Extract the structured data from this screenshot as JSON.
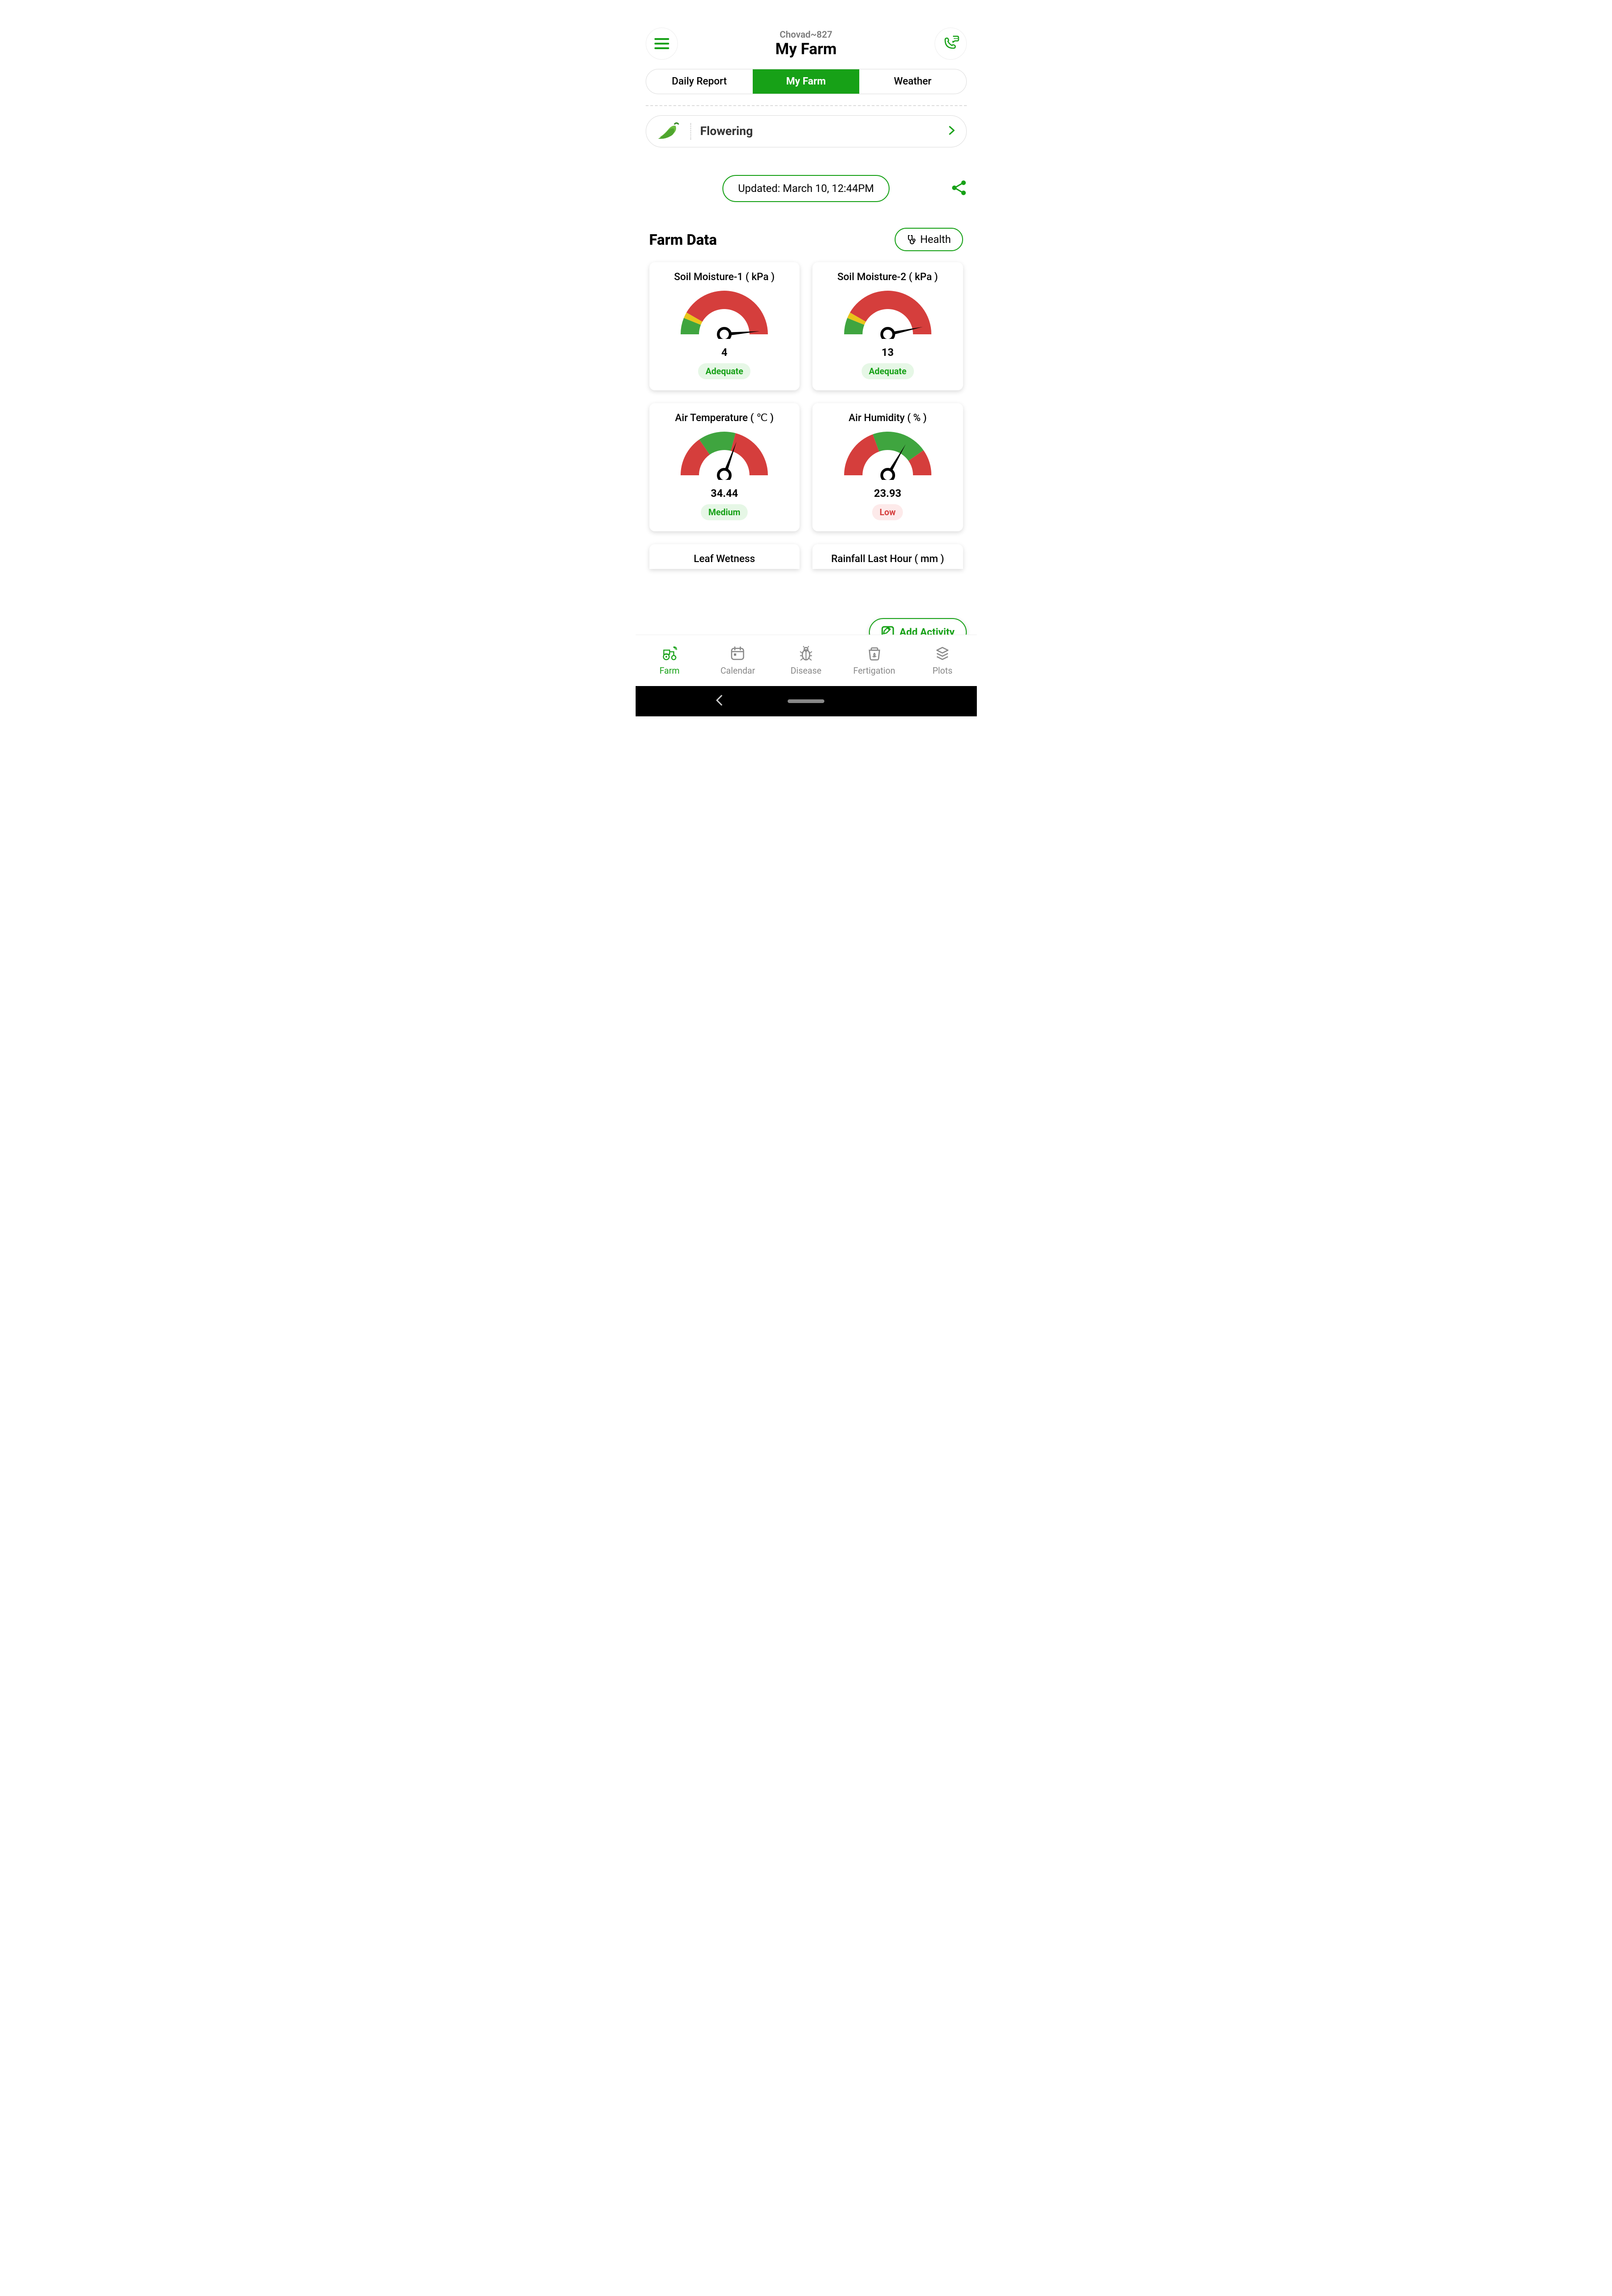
{
  "header": {
    "farm_id": "Chovad~827",
    "title": "My Farm"
  },
  "tabs": {
    "daily": "Daily Report",
    "farm": "My Farm",
    "weather": "Weather"
  },
  "crop": {
    "stage": "Flowering"
  },
  "updated": {
    "label": "Updated: March 10, 12:44PM"
  },
  "section": {
    "title": "Farm Data",
    "health": "Health"
  },
  "cards": [
    {
      "title": "Soil Moisture-1 ( kPa )",
      "value": "4",
      "status": "Adequate",
      "status_class": "status-green",
      "needle_angle": 175,
      "segments": "soil"
    },
    {
      "title": "Soil Moisture-2 ( kPa )",
      "value": "13",
      "status": "Adequate",
      "status_class": "status-green",
      "needle_angle": 168,
      "segments": "soil"
    },
    {
      "title": "Air Temperature ( ℃ )",
      "value": "34.44",
      "status": "Medium",
      "status_class": "status-green",
      "needle_angle": 110,
      "segments": "temp"
    },
    {
      "title": "Air Humidity ( % )",
      "value": "23.93",
      "status": "Low",
      "status_class": "status-red",
      "needle_angle": 120,
      "segments": "humid"
    }
  ],
  "partial_cards": [
    {
      "title": "Leaf Wetness"
    },
    {
      "title": "Rainfall Last Hour ( mm )"
    }
  ],
  "add_activity": "Add Activity",
  "bottom_nav": {
    "farm": "Farm",
    "calendar": "Calendar",
    "disease": "Disease",
    "fertigation": "Fertigation",
    "plots": "Plots"
  },
  "colors": {
    "green": "#17a117",
    "red": "#d53e3c",
    "yellow": "#e8c51a"
  },
  "chart_data": [
    {
      "type": "gauge",
      "title": "Soil Moisture-1 ( kPa )",
      "value": 4,
      "status": "Adequate",
      "unit": "kPa"
    },
    {
      "type": "gauge",
      "title": "Soil Moisture-2 ( kPa )",
      "value": 13,
      "status": "Adequate",
      "unit": "kPa"
    },
    {
      "type": "gauge",
      "title": "Air Temperature ( ℃ )",
      "value": 34.44,
      "status": "Medium",
      "unit": "℃"
    },
    {
      "type": "gauge",
      "title": "Air Humidity ( % )",
      "value": 23.93,
      "status": "Low",
      "unit": "%"
    }
  ]
}
